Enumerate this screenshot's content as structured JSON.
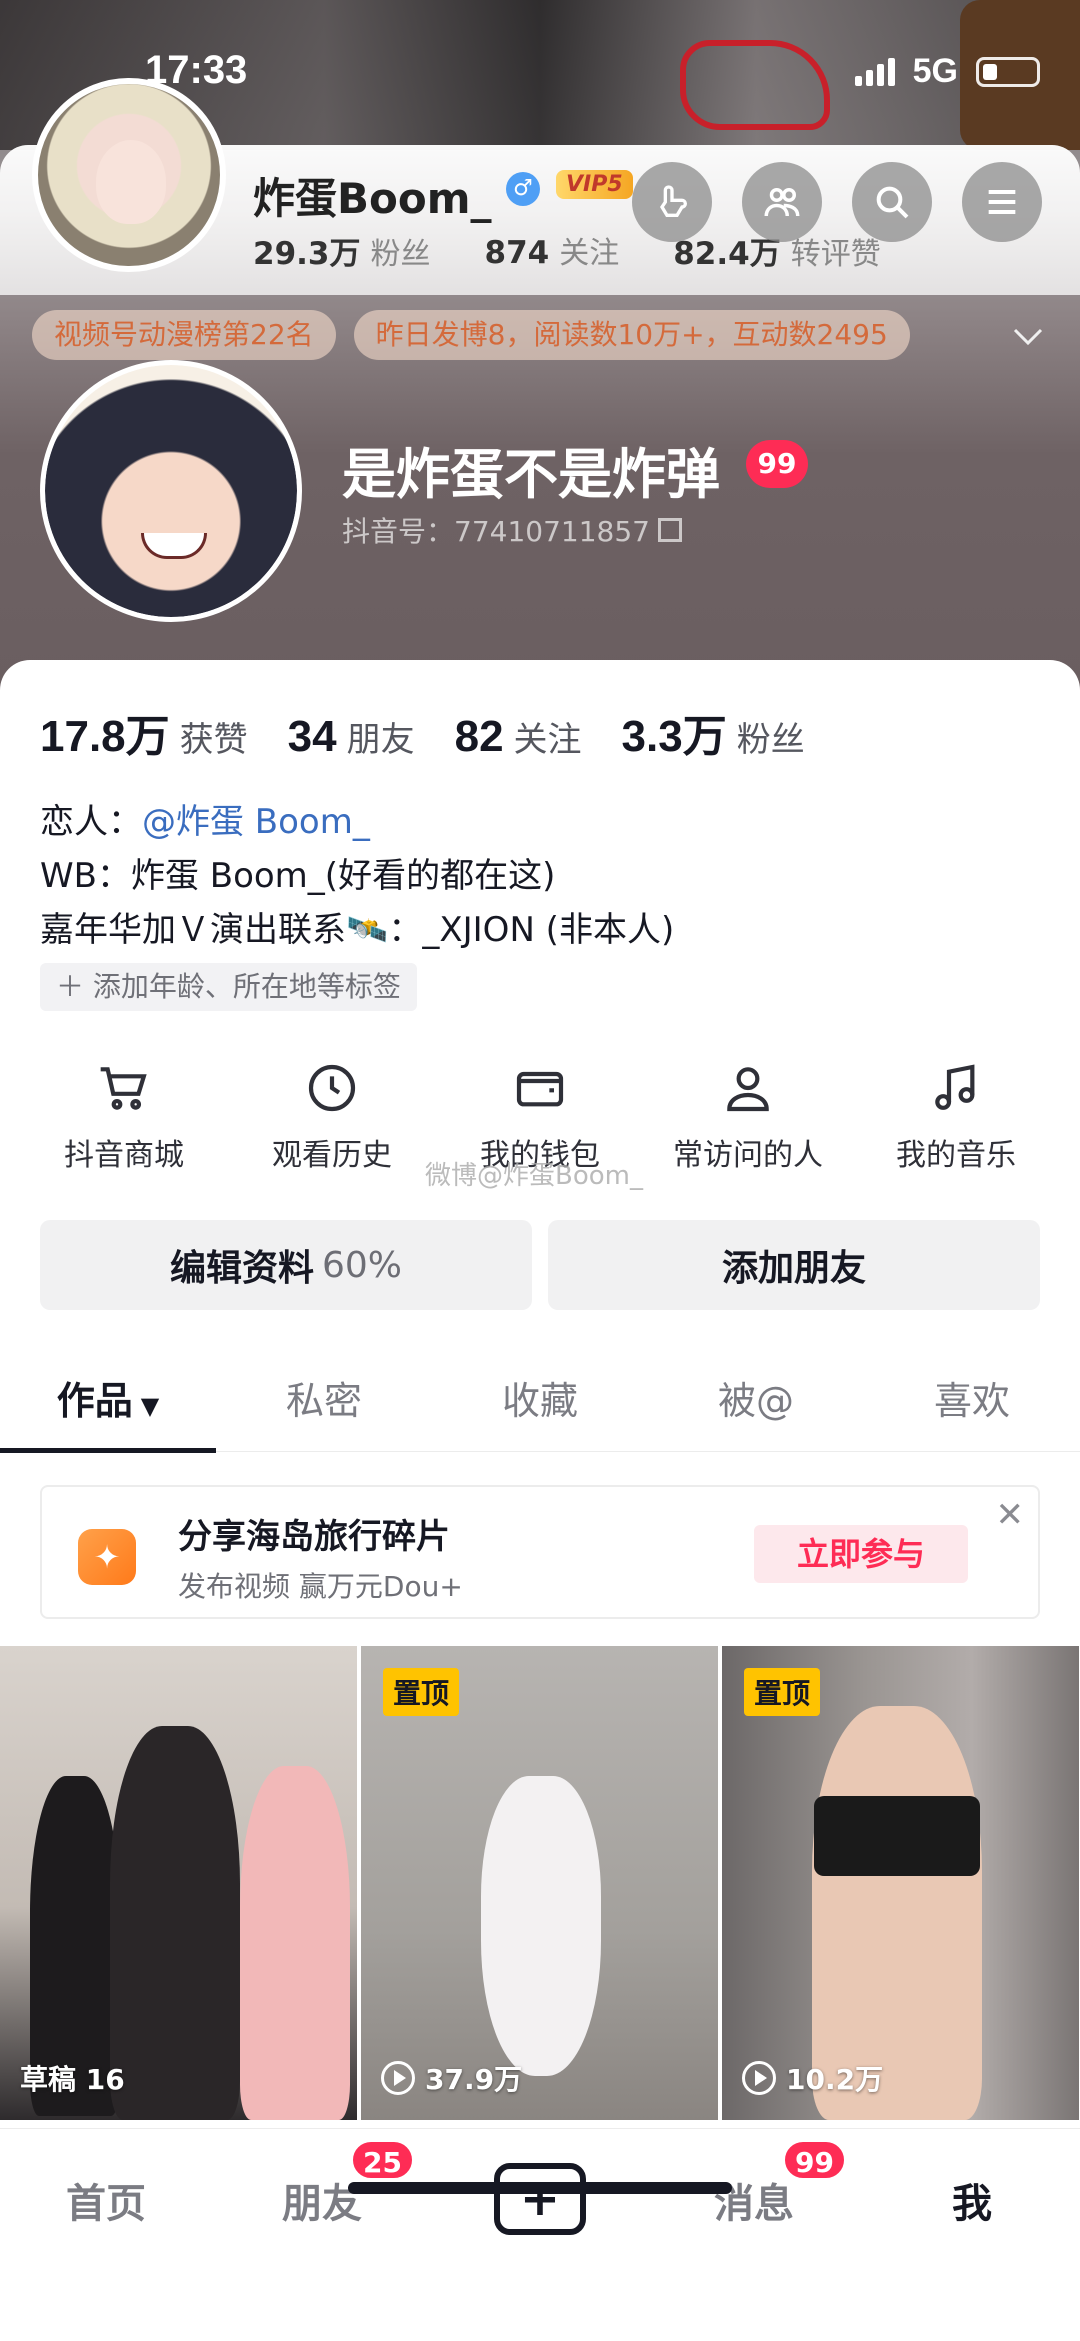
{
  "status": {
    "time": "17:33",
    "network": "5G"
  },
  "weibo_card": {
    "name": "炸蛋Boom_",
    "gender_mark": "♂",
    "vip_label": "VIP5",
    "stats": [
      {
        "value": "29.3万",
        "label": "粉丝"
      },
      {
        "value": "874",
        "label": "关注"
      },
      {
        "value": "82.4万",
        "label": "转评赞"
      }
    ],
    "icons": [
      "hand-point-icon",
      "group-icon",
      "search-icon",
      "menu-icon"
    ]
  },
  "hints": [
    "视频号动漫榜第22名",
    "昨日发博8，阅读数10万+，互动数2495"
  ],
  "profile": {
    "name": "是炸蛋不是炸弹",
    "badge": "99",
    "douyin_id": "抖音号：77410711857"
  },
  "counts": [
    {
      "value": "17.8万",
      "label": "获赞"
    },
    {
      "value": "34",
      "label": "朋友"
    },
    {
      "value": "82",
      "label": "关注"
    },
    {
      "value": "3.3万",
      "label": "粉丝"
    }
  ],
  "bio": {
    "lover_prefix": "恋人：",
    "lover_mention": "@炸蛋 Boom_",
    "wb_line": "WB：炸蛋 Boom_(好看的都在这)",
    "contact_line": "嘉年华加Ｖ演出联系🛰️：_XJION (非本人)"
  },
  "add_tag": "＋ 添加年龄、所在地等标签",
  "shortcuts": [
    {
      "icon": "cart-icon",
      "label": "抖音商城"
    },
    {
      "icon": "clock-icon",
      "label": "观看历史"
    },
    {
      "icon": "wallet-icon",
      "label": "我的钱包"
    },
    {
      "icon": "person-icon",
      "label": "常访问的人"
    },
    {
      "icon": "music-note-icon",
      "label": "我的音乐"
    }
  ],
  "watermark": "微博@炸蛋Boom_",
  "buttons": {
    "edit_label": "编辑资料",
    "edit_pct": "60%",
    "add_friend": "添加朋友"
  },
  "tabs": [
    {
      "label": "作品",
      "active": true,
      "suffix": "▼"
    },
    {
      "label": "私密"
    },
    {
      "label": "收藏"
    },
    {
      "label": "被@"
    },
    {
      "label": "喜欢"
    }
  ],
  "banner": {
    "title": "分享海岛旅行碎片",
    "subtitle": "发布视频 赢万元Dou+",
    "join": "立即参与",
    "close": "✕"
  },
  "videos": [
    {
      "label": "草稿 16",
      "pinned": false
    },
    {
      "label": "37.9万",
      "pinned": true,
      "pin_label": "置顶"
    },
    {
      "label": "10.2万",
      "pinned": true,
      "pin_label": "置顶"
    }
  ],
  "bottom_nav": {
    "home": "首页",
    "friends": "朋友",
    "friends_badge": "25",
    "plus": "+",
    "messages": "消息",
    "messages_badge": "99",
    "me": "我"
  },
  "colors": {
    "accent": "#fe2c55",
    "pin": "#ffc300",
    "mention": "#3a6dbf"
  }
}
